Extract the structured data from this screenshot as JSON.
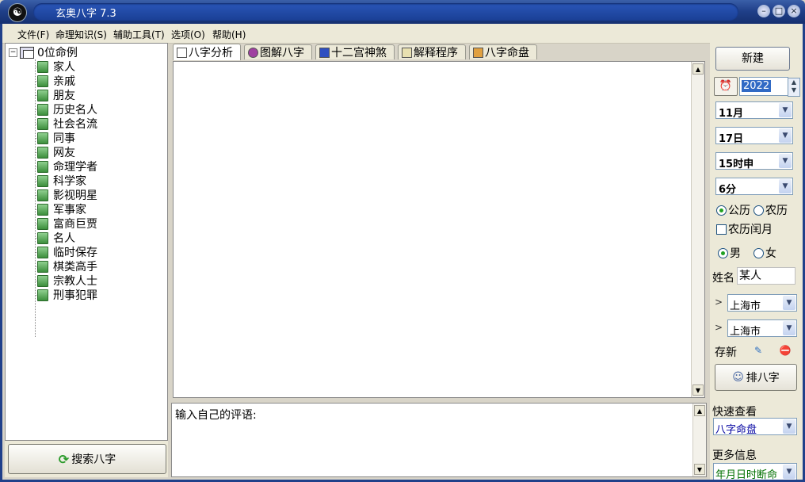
{
  "window": {
    "title": "玄奥八字 7.3",
    "logo": "☯"
  },
  "menu": [
    "文件(F)",
    "命理知识(S)",
    "辅助工具(T)",
    "选项(O)",
    "帮助(H)"
  ],
  "tree": {
    "root": "0位命例",
    "items": [
      "家人",
      "亲戚",
      "朋友",
      "历史名人",
      "社会名流",
      "同事",
      "网友",
      "命理学者",
      "科学家",
      "影视明星",
      "军事家",
      "富商巨贾",
      "名人",
      "临时保存",
      "棋类高手",
      "宗教人士",
      "刑事犯罪"
    ]
  },
  "search_button": "搜索八字",
  "tabs": [
    "八字分析",
    "图解八字",
    "十二宫神煞",
    "解释程序",
    "八字命盘"
  ],
  "comment_label": "输入自己的评语:",
  "right": {
    "new_button": "新建",
    "year": "2022",
    "month": "11月",
    "day": "17日",
    "hour": "15时申",
    "minute": "6分",
    "calendar": {
      "solar": "公历",
      "lunar": "农历",
      "selected": "solar"
    },
    "leap_month": "农历闰月",
    "gender": {
      "male": "男",
      "female": "女",
      "selected": "male"
    },
    "name_label": "姓名",
    "name_value": "某人",
    "city1": "上海市",
    "city2": "上海市",
    "save_label": "存新",
    "pai_button": "排八字",
    "quick_label": "快速查看",
    "quick_value": "八字命盘",
    "more_label": "更多信息",
    "more_value": "年月日时断命"
  }
}
